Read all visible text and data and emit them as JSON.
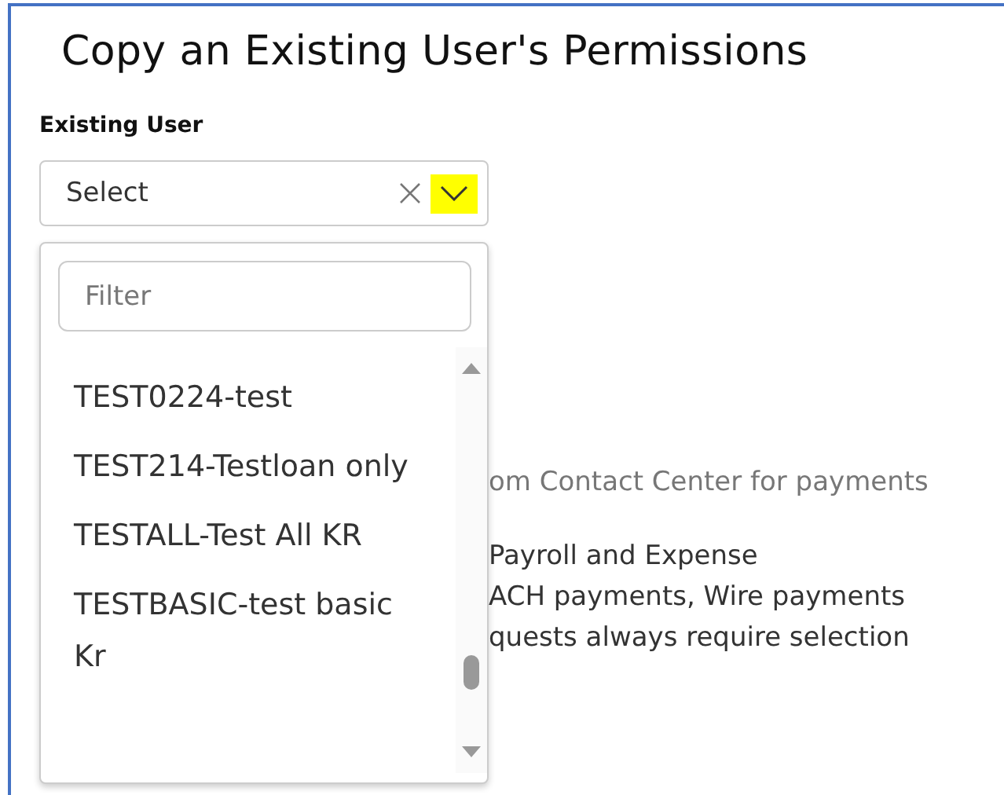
{
  "title": "Copy an Existing User's Permissions",
  "field": {
    "label": "Existing User",
    "value": "Select",
    "expanded": true
  },
  "dropdown": {
    "filter_placeholder": "Filter",
    "options": [
      {
        "label": "TEST0224-test",
        "selected": false
      },
      {
        "label": "TEST214-Testloan only",
        "selected": false
      },
      {
        "label": "TESTALL-Test All KR",
        "selected": false
      },
      {
        "label": "TESTBASIC-test basic Kr",
        "selected": false
      }
    ]
  },
  "background_text": [
    {
      "text": "om Contact Center for payments",
      "kind": "muted"
    },
    {
      "text": "Payroll and Expense",
      "kind": "body"
    },
    {
      "text": "ACH payments, Wire payments",
      "kind": "body"
    },
    {
      "text": "quests always require selection",
      "kind": "body"
    }
  ]
}
